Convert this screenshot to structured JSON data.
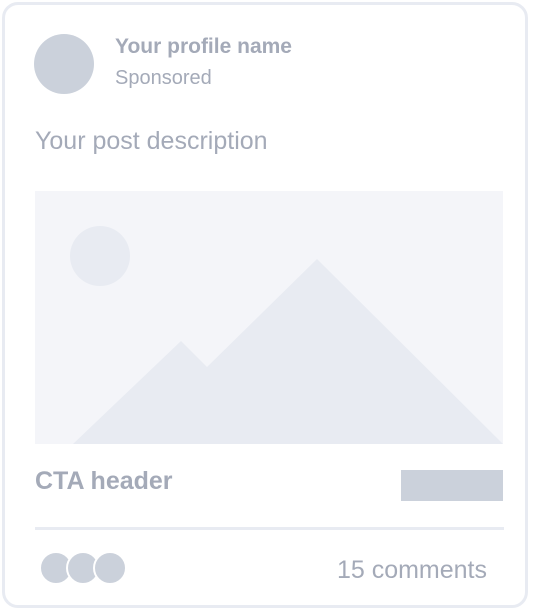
{
  "profile": {
    "name": "Your profile name",
    "label": "Sponsored"
  },
  "post": {
    "description": "Your post description",
    "image_icon": "image-placeholder-icon"
  },
  "cta": {
    "header": "CTA header"
  },
  "footer": {
    "comments": "15 comments"
  },
  "colors": {
    "border": "#E8EBF2",
    "placeholder_fill": "#CBD1DB",
    "text": "#A4AAB8",
    "media_bg": "#F4F5F9",
    "media_shapes": "#E8EBF2"
  }
}
